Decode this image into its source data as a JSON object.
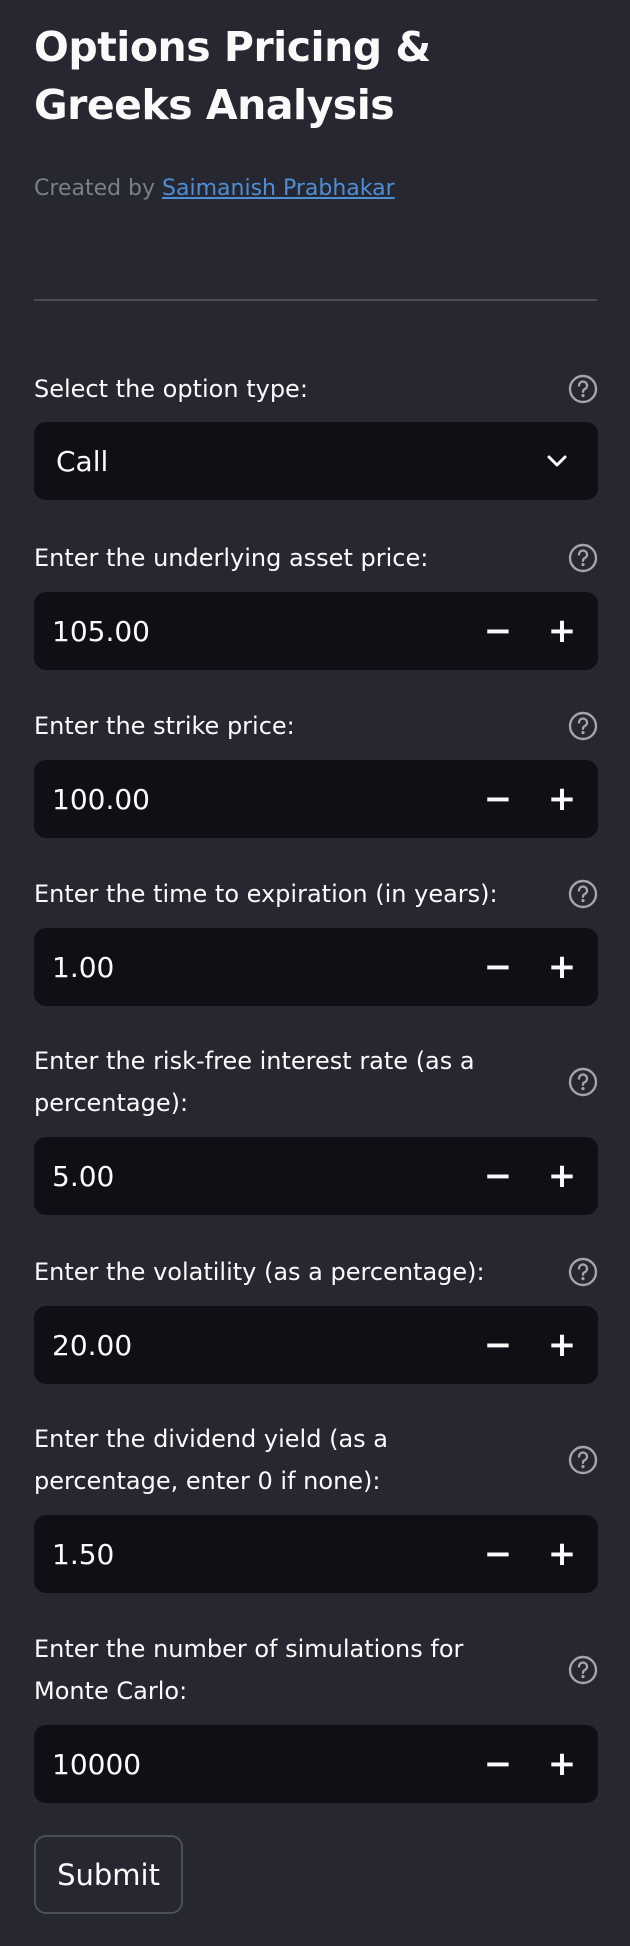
{
  "sidebar": {
    "title": "Options Pricing & Greeks Analysis",
    "credit_prefix": "Created by ",
    "credit_author": "Saimanish Prabhakar"
  },
  "fields": {
    "option_type": {
      "label": "Select the option type:",
      "value": "Call"
    },
    "asset_price": {
      "label": "Enter the underlying asset price:",
      "value": "105.00"
    },
    "strike_price": {
      "label": "Enter the strike price:",
      "value": "100.00"
    },
    "time_to_expiration": {
      "label": "Enter the time to expiration (in years):",
      "value": "1.00"
    },
    "risk_free_rate": {
      "label": "Enter the risk-free interest rate (as a percentage):",
      "value": "5.00"
    },
    "volatility": {
      "label": "Enter the volatility (as a percentage):",
      "value": "20.00"
    },
    "dividend_yield": {
      "label": "Enter the dividend yield (as a percentage, enter 0 if none):",
      "value": "1.50"
    },
    "simulations": {
      "label": "Enter the number of simulations for Monte Carlo:",
      "value": "10000"
    }
  },
  "stepper": {
    "minus": "−",
    "plus": "+"
  },
  "submit_label": "Submit",
  "colors": {
    "background": "#262730",
    "input_background": "#0f1016",
    "link": "#4e8ed6",
    "muted_text": "#7d7f88"
  }
}
